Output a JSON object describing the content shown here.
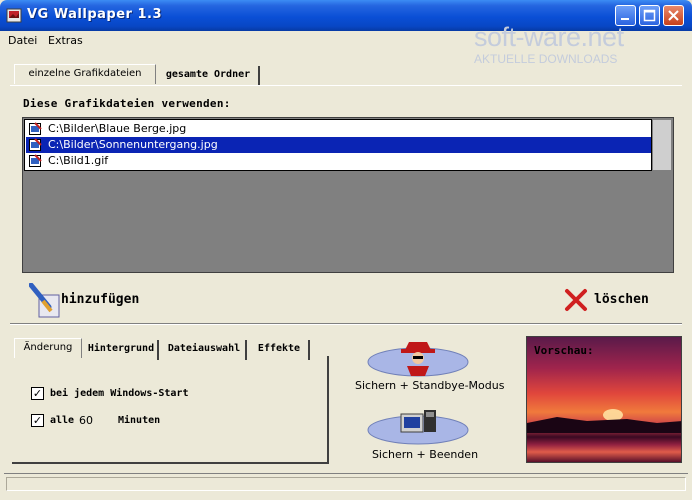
{
  "window": {
    "title": "VG Wallpaper 1.3"
  },
  "menu": {
    "items": [
      "Datei",
      "Extras"
    ]
  },
  "watermark": {
    "brand": "soft-ware.net",
    "tagline": "AKTUELLE DOWNLOADS"
  },
  "top_tabs": [
    "einzelne Grafikdateien",
    "gesamte Ordner"
  ],
  "files": {
    "heading": "Diese Grafikdateien verwenden:",
    "items": [
      "C:\\Bilder\\Blaue Berge.jpg",
      "C:\\Bilder\\Sonnenuntergang.jpg",
      "C:\\Bild1.gif"
    ],
    "selected_index": 1
  },
  "actions": {
    "add_label": "hinzufügen",
    "delete_label": "löschen"
  },
  "bottom_tabs": [
    "Änderung",
    "Hintergrund",
    "Dateiauswahl",
    "Effekte"
  ],
  "options": {
    "on_start_label": "bei jedem Windows-Start",
    "on_start_checked": true,
    "every_label": "alle",
    "every_value": "60",
    "minutes_label": "Minuten",
    "every_checked": true
  },
  "buttons": {
    "save_standby": "Sichern + Standbye-Modus",
    "save_exit": "Sichern + Beenden"
  },
  "preview": {
    "label": "Vorschau:"
  },
  "colors": {
    "titlebar": "#0846c4",
    "selection": "#0a24b4",
    "face": "#ece9d8"
  }
}
